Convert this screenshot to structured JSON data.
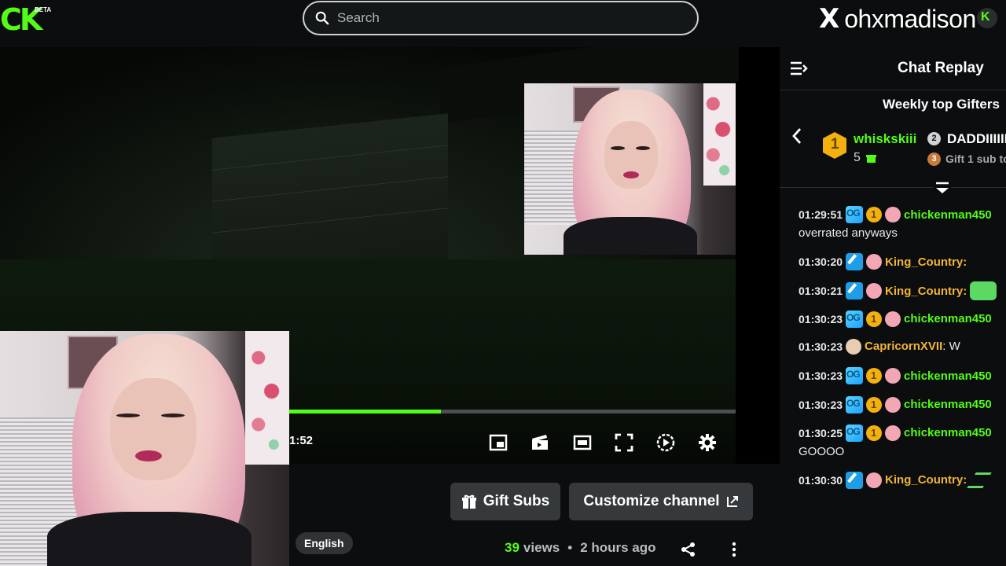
{
  "header": {
    "logo_text": "CK",
    "logo_beta": "BETA",
    "search_placeholder": "Search",
    "x_icon": "X",
    "streamer_handle": "ohxmadison",
    "brand_color": "#53fc18"
  },
  "player": {
    "time_text": "1:52",
    "progress": 0.34,
    "controls": [
      "pip-icon",
      "theater-clip-icon",
      "theater-icon",
      "fullscreen-icon",
      "replay-speed-icon",
      "settings-icon"
    ]
  },
  "actions": {
    "gift_subs_label": "Gift Subs",
    "customize_label": "Customize channel",
    "language_label": "English",
    "views_count": "39",
    "views_label": "views",
    "posted": "2 hours ago"
  },
  "chat": {
    "title": "Chat Replay",
    "gifters_title": "Weekly top Gifters",
    "gifters": [
      {
        "rank": "1",
        "name": "whiskskiii",
        "count": "5"
      },
      {
        "rank": "2",
        "name": "DADDIIIIII"
      },
      {
        "rank": "3",
        "text": "Gift 1 sub to"
      }
    ],
    "messages": [
      {
        "time": "01:29:51",
        "badges": [
          "og",
          "sub",
          "bunny"
        ],
        "user": "chickenman450",
        "color": "green",
        "text": "overrated anyways"
      },
      {
        "time": "01:30:20",
        "badges": [
          "mod",
          "bunny"
        ],
        "user": "King_Country:",
        "color": "gold"
      },
      {
        "time": "01:30:21",
        "badges": [
          "mod",
          "bunny"
        ],
        "user": "King_Country:",
        "color": "gold",
        "emote": true
      },
      {
        "time": "01:30:23",
        "badges": [
          "og",
          "sub",
          "bunny"
        ],
        "user": "chickenman450",
        "color": "green"
      },
      {
        "time": "01:30:23",
        "badges": [
          "tan"
        ],
        "user": "CapricornXVII",
        "color": "gold",
        "inline": ": W"
      },
      {
        "time": "01:30:23",
        "badges": [
          "og",
          "sub",
          "bunny"
        ],
        "user": "chickenman450",
        "color": "green"
      },
      {
        "time": "01:30:23",
        "badges": [
          "og",
          "sub",
          "bunny"
        ],
        "user": "chickenman450",
        "color": "green"
      },
      {
        "time": "01:30:25",
        "badges": [
          "og",
          "sub",
          "bunny"
        ],
        "user": "chickenman450",
        "color": "green",
        "text": "GOOOO"
      },
      {
        "time": "01:30:30",
        "badges": [
          "mod",
          "bunny"
        ],
        "user": "King_Country:",
        "color": "gold",
        "emote2": true
      }
    ]
  }
}
